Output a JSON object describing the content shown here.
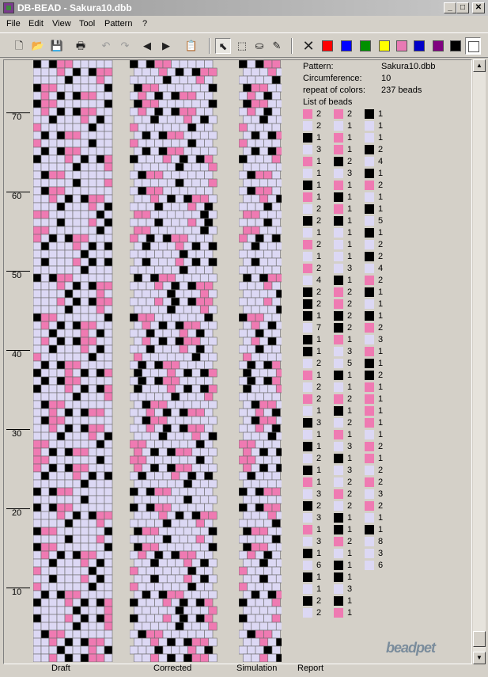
{
  "window": {
    "title": "DB-BEAD - Sakura10.dbb"
  },
  "menu": [
    "File",
    "Edit",
    "View",
    "Tool",
    "Pattern",
    "?"
  ],
  "toolbar": {
    "tools": [
      "new-file",
      "open-folder",
      "save",
      "print",
      "undo",
      "redo",
      "arrow-left",
      "arrow-right",
      "paste",
      "pointer",
      "select-rect",
      "fill-bucket",
      "eyedropper",
      "clear-x"
    ],
    "palette": [
      "#ff0000",
      "#0000ff",
      "#009000",
      "#ffff00",
      "#e87ab4",
      "#0000c8",
      "#800080",
      "#000000",
      "#ffffff"
    ]
  },
  "colors": {
    "lilac": "#dcd8f4",
    "pink": "#ef7ab2",
    "black": "#000000"
  },
  "ruler": [
    "70",
    "60",
    "50",
    "40",
    "30",
    "20",
    "10"
  ],
  "panels": {
    "draft": "Draft",
    "corrected": "Corrected",
    "simulation": "Simulation",
    "report": "Report"
  },
  "report": {
    "pattern_label": "Pattern:",
    "pattern_value": "Sakura10.dbb",
    "circumference_label": "Circumference:",
    "circumference_value": "10",
    "repeat_label": "repeat of colors:",
    "repeat_value": "237 beads",
    "list_label": "List of beads",
    "columns": [
      [
        [
          "P",
          "2"
        ],
        [
          "L",
          "2"
        ],
        [
          "B",
          "1"
        ],
        [
          "L",
          "3"
        ],
        [
          "P",
          "1"
        ],
        [
          "L",
          "1"
        ],
        [
          "B",
          "1"
        ],
        [
          "P",
          "1"
        ],
        [
          "L",
          "2"
        ],
        [
          "B",
          "2"
        ],
        [
          "L",
          "1"
        ],
        [
          "P",
          "2"
        ],
        [
          "L",
          "1"
        ],
        [
          "P",
          "2"
        ],
        [
          "L",
          "4"
        ],
        [
          "B",
          "2"
        ],
        [
          "B",
          "2"
        ],
        [
          "B",
          "1"
        ],
        [
          "L",
          "7"
        ],
        [
          "B",
          "1"
        ],
        [
          "B",
          "1"
        ],
        [
          "L",
          "2"
        ],
        [
          "P",
          "1"
        ],
        [
          "L",
          "2"
        ],
        [
          "P",
          "2"
        ],
        [
          "L",
          "1"
        ],
        [
          "B",
          "3"
        ],
        [
          "L",
          "1"
        ],
        [
          "B",
          "1"
        ],
        [
          "L",
          "2"
        ],
        [
          "B",
          "1"
        ],
        [
          "P",
          "1"
        ],
        [
          "L",
          "3"
        ],
        [
          "B",
          "2"
        ],
        [
          "L",
          "3"
        ],
        [
          "P",
          "1"
        ],
        [
          "L",
          "3"
        ],
        [
          "B",
          "1"
        ],
        [
          "L",
          "6"
        ],
        [
          "B",
          "1"
        ],
        [
          "L",
          "1"
        ],
        [
          "B",
          "2"
        ],
        [
          "L",
          "2"
        ]
      ],
      [
        [
          "P",
          "2"
        ],
        [
          "L",
          "1"
        ],
        [
          "P",
          "1"
        ],
        [
          "P",
          "1"
        ],
        [
          "B",
          "2"
        ],
        [
          "L",
          "3"
        ],
        [
          "P",
          "1"
        ],
        [
          "B",
          "1"
        ],
        [
          "P",
          "1"
        ],
        [
          "B",
          "1"
        ],
        [
          "L",
          "1"
        ],
        [
          "L",
          "1"
        ],
        [
          "L",
          "1"
        ],
        [
          "L",
          "3"
        ],
        [
          "B",
          "1"
        ],
        [
          "P",
          "2"
        ],
        [
          "P",
          "2"
        ],
        [
          "B",
          "2"
        ],
        [
          "B",
          "2"
        ],
        [
          "P",
          "1"
        ],
        [
          "L",
          "3"
        ],
        [
          "L",
          "5"
        ],
        [
          "B",
          "1"
        ],
        [
          "L",
          "1"
        ],
        [
          "P",
          "2"
        ],
        [
          "B",
          "1"
        ],
        [
          "L",
          "2"
        ],
        [
          "P",
          "1"
        ],
        [
          "L",
          "3"
        ],
        [
          "B",
          "1"
        ],
        [
          "L",
          "3"
        ],
        [
          "L",
          "2"
        ],
        [
          "P",
          "2"
        ],
        [
          "L",
          "2"
        ],
        [
          "B",
          "1"
        ],
        [
          "B",
          "1"
        ],
        [
          "P",
          "2"
        ],
        [
          "L",
          "1"
        ],
        [
          "B",
          "1"
        ],
        [
          "B",
          "1"
        ],
        [
          "L",
          "3"
        ],
        [
          "B",
          "1"
        ],
        [
          "P",
          "1"
        ]
      ],
      [
        [
          "B",
          "1"
        ],
        [
          "L",
          "1"
        ],
        [
          "L",
          "1"
        ],
        [
          "B",
          "2"
        ],
        [
          "L",
          "4"
        ],
        [
          "B",
          "1"
        ],
        [
          "P",
          "2"
        ],
        [
          "L",
          "1"
        ],
        [
          "B",
          "1"
        ],
        [
          "L",
          "5"
        ],
        [
          "B",
          "1"
        ],
        [
          "L",
          "2"
        ],
        [
          "B",
          "2"
        ],
        [
          "L",
          "4"
        ],
        [
          "P",
          "2"
        ],
        [
          "B",
          "1"
        ],
        [
          "L",
          "1"
        ],
        [
          "B",
          "1"
        ],
        [
          "P",
          "2"
        ],
        [
          "L",
          "3"
        ],
        [
          "P",
          "1"
        ],
        [
          "B",
          "1"
        ],
        [
          "B",
          "2"
        ],
        [
          "P",
          "1"
        ],
        [
          "P",
          "1"
        ],
        [
          "P",
          "1"
        ],
        [
          "P",
          "1"
        ],
        [
          "L",
          "1"
        ],
        [
          "P",
          "2"
        ],
        [
          "P",
          "1"
        ],
        [
          "L",
          "2"
        ],
        [
          "P",
          "2"
        ],
        [
          "L",
          "3"
        ],
        [
          "P",
          "2"
        ],
        [
          "L",
          "1"
        ],
        [
          "B",
          "1"
        ],
        [
          "L",
          "8"
        ],
        [
          "L",
          "3"
        ],
        [
          "L",
          "6"
        ]
      ]
    ]
  }
}
